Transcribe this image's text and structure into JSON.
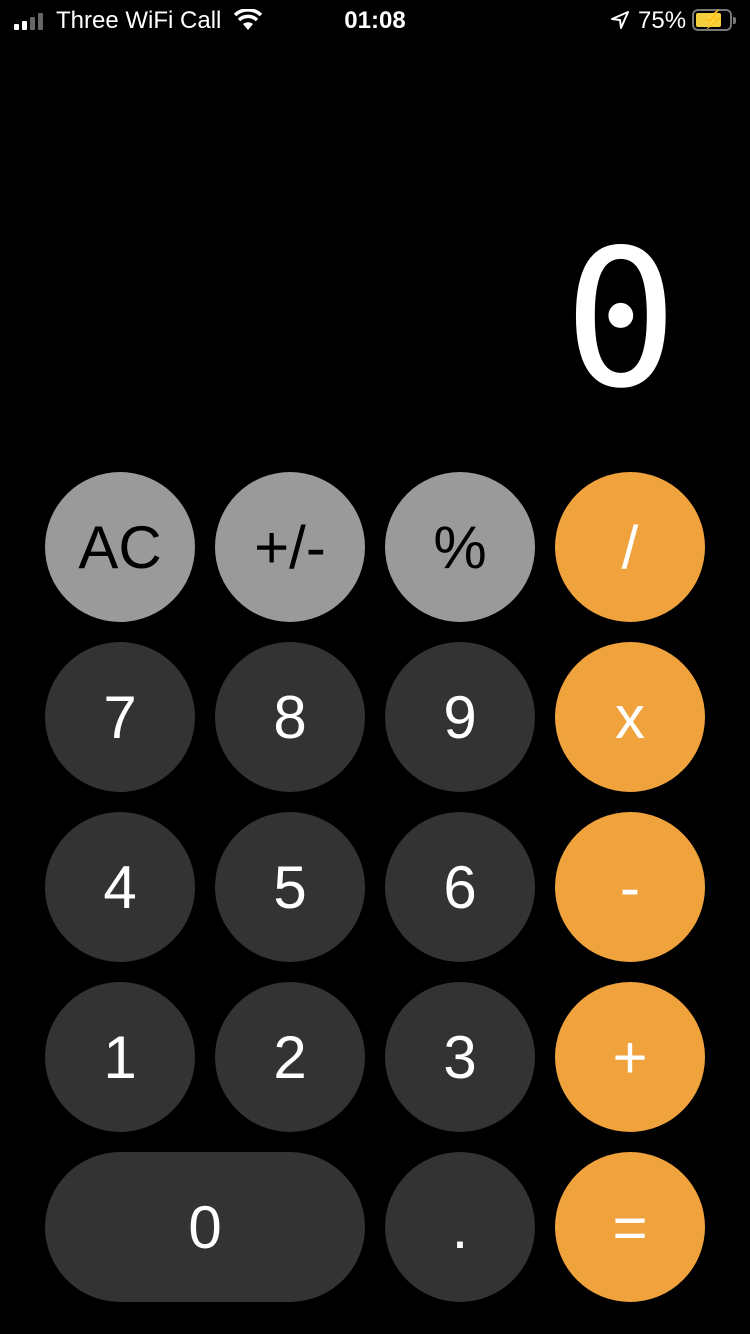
{
  "status_bar": {
    "carrier": "Three WiFi Call",
    "time": "01:08",
    "battery_percent": "75%",
    "battery_level": 0.75,
    "charging": true,
    "icons": [
      "signal-icon",
      "wifi-icon",
      "location-arrow-icon",
      "battery-charging-icon"
    ]
  },
  "display": {
    "value": "0"
  },
  "colors": {
    "function": "#9a9a9a",
    "digit": "#333333",
    "operator": "#f0a33c"
  },
  "keys": {
    "ac": "AC",
    "sign": "+/-",
    "percent": "%",
    "divide": "/",
    "seven": "7",
    "eight": "8",
    "nine": "9",
    "multiply": "x",
    "four": "4",
    "five": "5",
    "six": "6",
    "subtract": "-",
    "one": "1",
    "two": "2",
    "three": "3",
    "add": "+",
    "zero": "0",
    "decimal": ".",
    "equals": "="
  }
}
